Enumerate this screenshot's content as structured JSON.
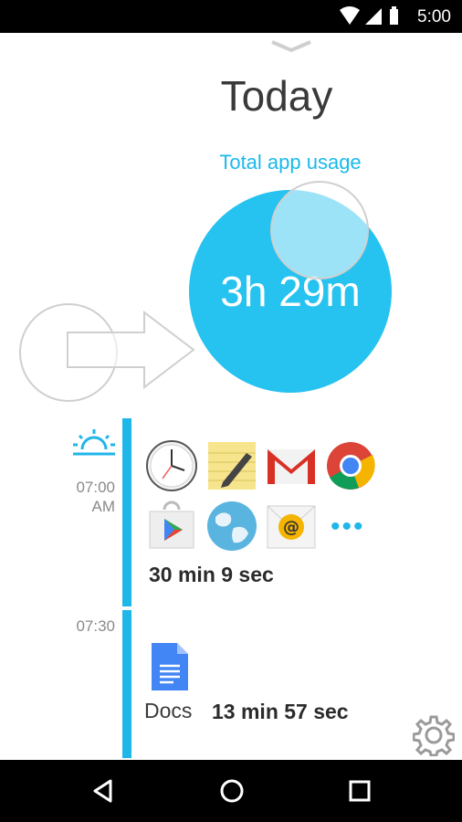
{
  "status_bar": {
    "time": "5:00"
  },
  "header": {
    "title": "Today",
    "subtitle": "Total app usage"
  },
  "usage": {
    "total": "3h 29m"
  },
  "timeline": {
    "blocks": [
      {
        "time_line1": "07:00",
        "time_line2": "AM",
        "apps": [
          "clock",
          "notes",
          "gmail",
          "chrome",
          "play-store",
          "browser",
          "email"
        ],
        "more": "•••",
        "duration": "30 min 9 sec"
      },
      {
        "time_line1": "07:30",
        "apps": [
          "docs"
        ],
        "label": "Docs",
        "duration": "13 min 57 sec"
      }
    ]
  },
  "colors": {
    "accent": "#26c2f0",
    "timeline": "#1fb6e8",
    "status_bar": "#000000"
  }
}
